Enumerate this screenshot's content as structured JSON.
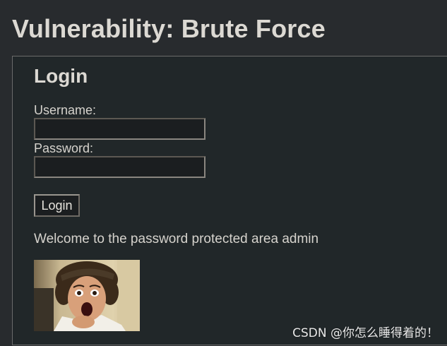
{
  "page": {
    "title": "Vulnerability: Brute Force"
  },
  "login": {
    "heading": "Login",
    "username_label": "Username:",
    "username_value": "",
    "password_label": "Password:",
    "password_value": "",
    "button_label": "Login"
  },
  "result": {
    "welcome_text": "Welcome to the password protected area admin"
  },
  "watermark": {
    "text": "CSDN @你怎么睡得着的！"
  },
  "colors": {
    "page_background": "#282b2e",
    "panel_background": "#212729",
    "text": "#d6d3cd"
  }
}
